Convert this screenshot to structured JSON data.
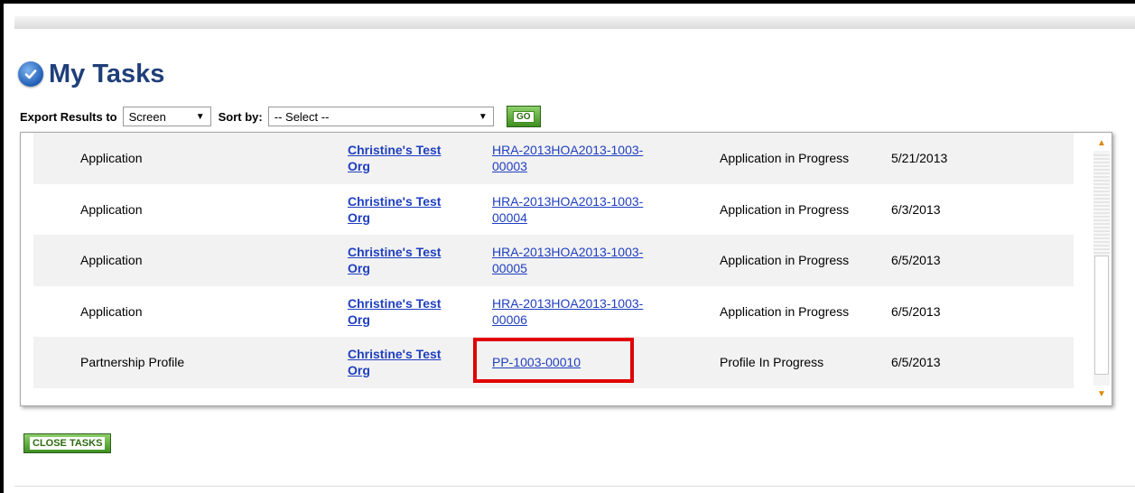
{
  "page": {
    "title": "My Tasks",
    "icon": "check-circle-icon"
  },
  "toolbar": {
    "export_label": "Export Results to",
    "export_value": "Screen",
    "sort_label": "Sort by:",
    "sort_value": "-- Select --",
    "go_label": "GO"
  },
  "tasks": {
    "rows": [
      {
        "type": "Application",
        "org_line1": "Christine's Test",
        "org_line2": "Org",
        "id_line1": "HRA-2013HOA2013-1003-",
        "id_line2": "00003",
        "status": "Application in Progress",
        "date": "5/21/2013"
      },
      {
        "type": "Application",
        "org_line1": "Christine's Test",
        "org_line2": "Org",
        "id_line1": "HRA-2013HOA2013-1003-",
        "id_line2": "00004",
        "status": "Application in Progress",
        "date": "6/3/2013"
      },
      {
        "type": "Application",
        "org_line1": "Christine's Test",
        "org_line2": "Org",
        "id_line1": "HRA-2013HOA2013-1003-",
        "id_line2": "00005",
        "status": "Application in Progress",
        "date": "6/5/2013"
      },
      {
        "type": "Application",
        "org_line1": "Christine's Test",
        "org_line2": "Org",
        "id_line1": "HRA-2013HOA2013-1003-",
        "id_line2": "00006",
        "status": "Application in Progress",
        "date": "6/5/2013"
      },
      {
        "type": "Partnership Profile",
        "org_line1": "Christine's Test",
        "org_line2": "Org",
        "id_line1": "PP-1003-00010",
        "id_line2": "",
        "status": "Profile In Progress",
        "date": "6/5/2013"
      }
    ]
  },
  "footer": {
    "close_label": "CLOSE TASKS"
  },
  "colors": {
    "title": "#1f3f7a",
    "link": "#1f3fc0",
    "button_green": "#3f8f20",
    "highlight": "#e00000"
  }
}
